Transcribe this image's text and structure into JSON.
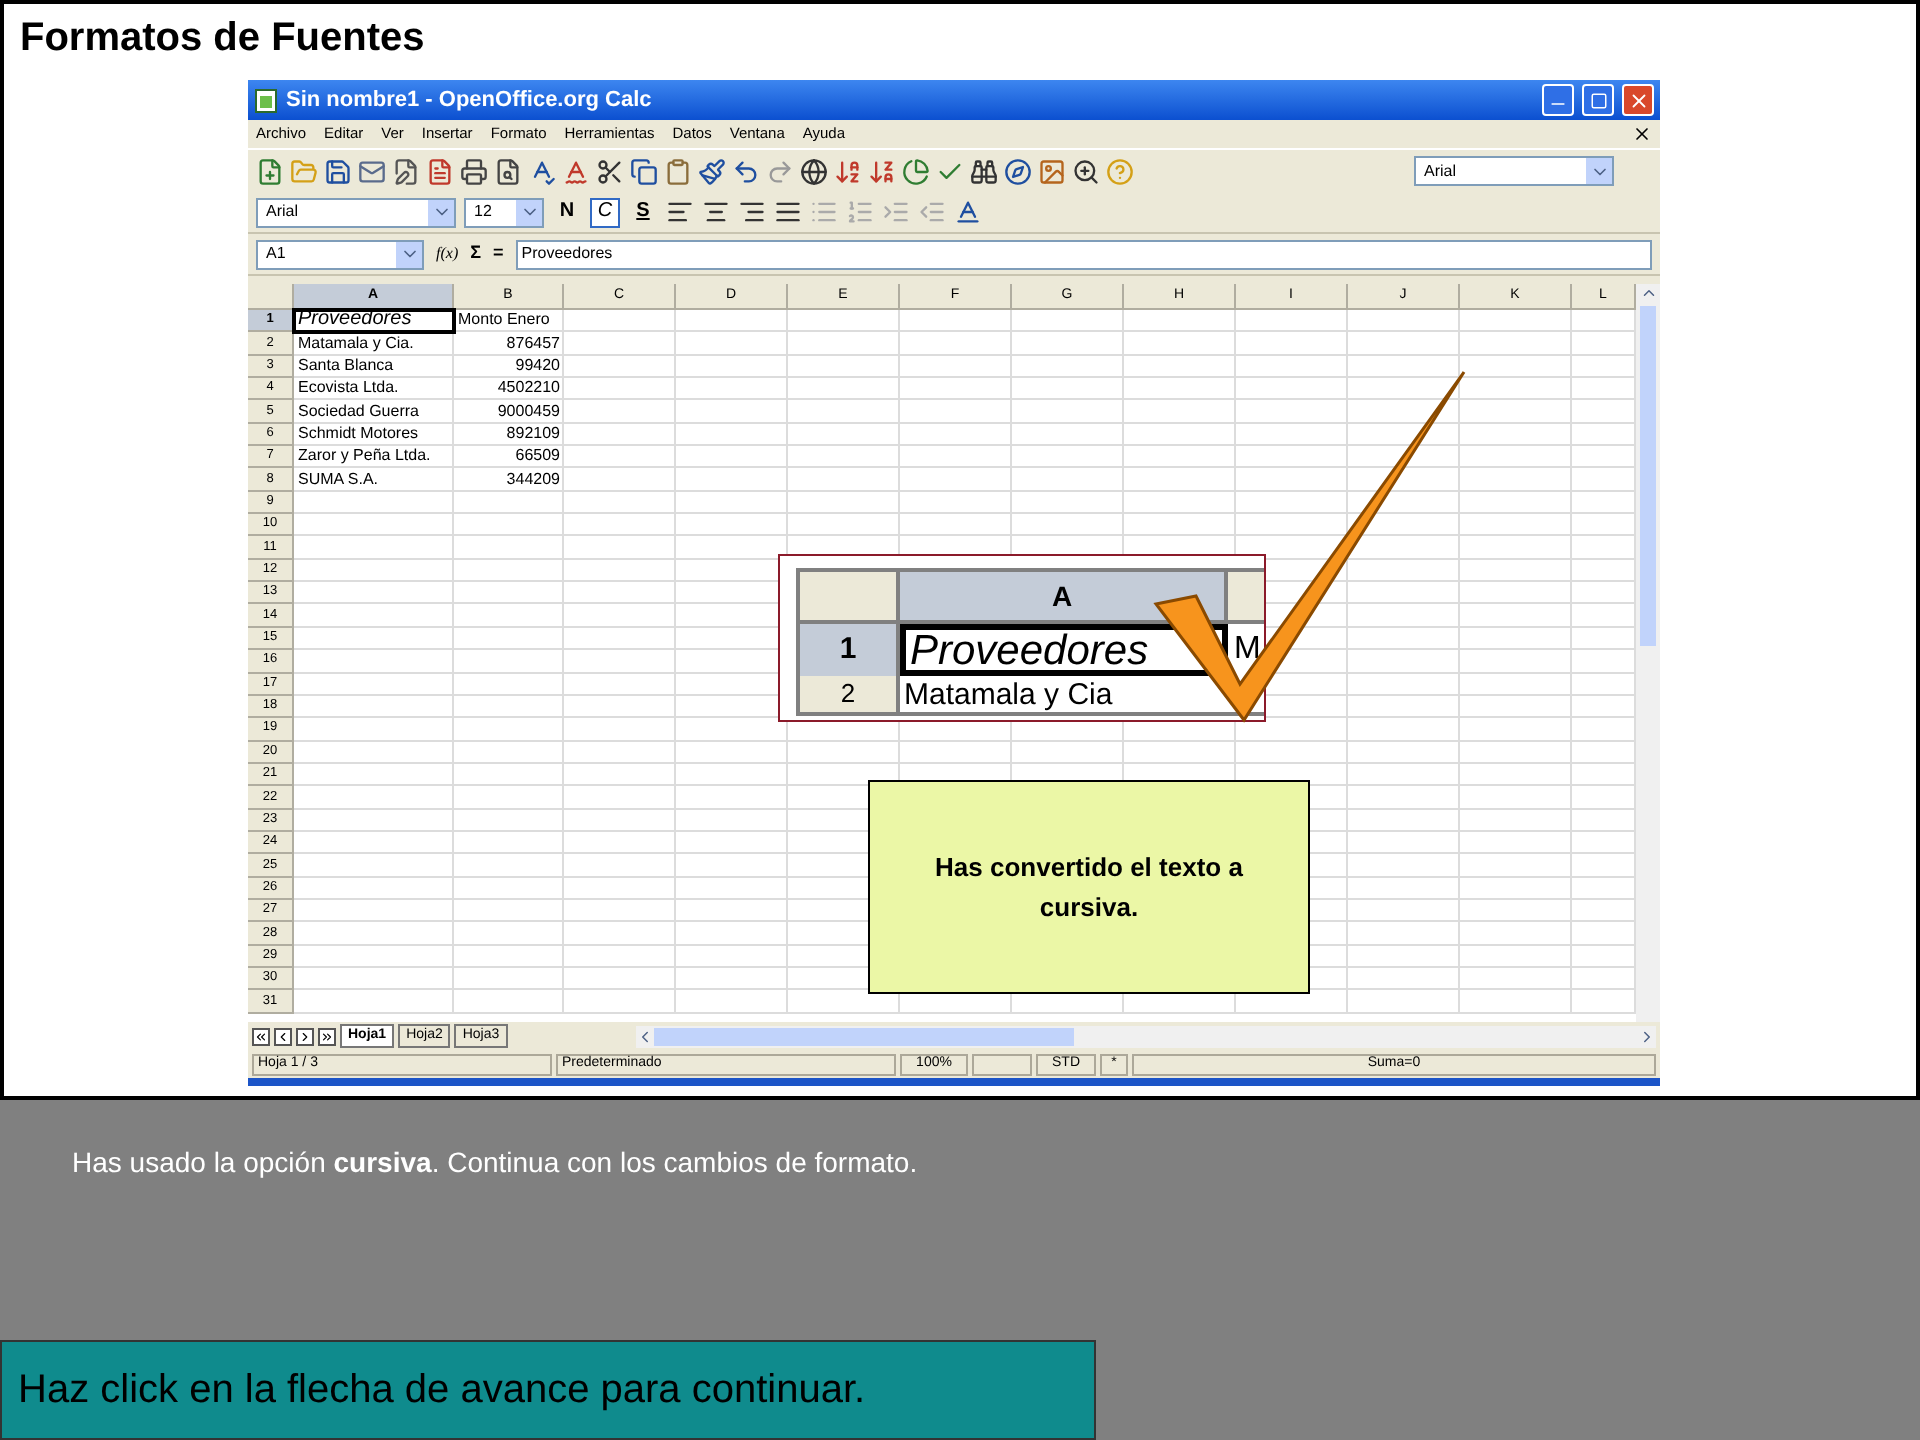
{
  "slide_title": "Formatos de Fuentes",
  "window": {
    "title": "Sin nombre1 - OpenOffice.org Calc"
  },
  "menu": [
    "Archivo",
    "Editar",
    "Ver",
    "Insertar",
    "Formato",
    "Herramientas",
    "Datos",
    "Ventana",
    "Ayuda"
  ],
  "standard_toolbar": {
    "font_box": "Arial"
  },
  "format_toolbar": {
    "font": "Arial",
    "size": "12",
    "bold_label": "N",
    "italic_label": "C",
    "italic_on": true,
    "underline_label": "S"
  },
  "formula_bar": {
    "cell_ref": "A1",
    "function_label": "f(x)",
    "sum_label": "Σ",
    "equals_label": "=",
    "value": "Proveedores"
  },
  "sheet": {
    "columns": [
      {
        "label": "A",
        "selected": true
      },
      {
        "label": "B",
        "selected": false
      },
      {
        "label": "C",
        "selected": false
      },
      {
        "label": "D",
        "selected": false
      },
      {
        "label": "E",
        "selected": false
      },
      {
        "label": "F",
        "selected": false
      },
      {
        "label": "G",
        "selected": false
      },
      {
        "label": "H",
        "selected": false
      },
      {
        "label": "I",
        "selected": false
      },
      {
        "label": "J",
        "selected": false
      },
      {
        "label": "K",
        "selected": false
      },
      {
        "label": "L",
        "selected": false
      }
    ],
    "row_numbers": [
      "1",
      "2",
      "3",
      "4",
      "5",
      "6",
      "7",
      "8",
      "9",
      "10",
      "11",
      "12",
      "13",
      "14",
      "15",
      "16",
      "17",
      "18",
      "19",
      "20",
      "21",
      "22",
      "23",
      "24",
      "25",
      "26",
      "27",
      "28",
      "29",
      "30",
      "31"
    ],
    "rows": [
      {
        "kind": "header",
        "cells": [
          "Proveedores",
          "Monto Enero"
        ],
        "italic": true,
        "selected": true
      },
      {
        "kind": "data",
        "cells": [
          "Matamala y Cia.",
          "876457"
        ],
        "italic": false,
        "selected": false
      },
      {
        "kind": "data",
        "cells": [
          "Santa Blanca",
          "99420"
        ],
        "italic": false,
        "selected": false
      },
      {
        "kind": "data",
        "cells": [
          "Ecovista Ltda.",
          "4502210"
        ],
        "italic": false,
        "selected": false
      },
      {
        "kind": "data",
        "cells": [
          "Sociedad Guerra",
          "9000459"
        ],
        "italic": false,
        "selected": false
      },
      {
        "kind": "data",
        "cells": [
          "Schmidt Motores",
          "892109"
        ],
        "italic": false,
        "selected": false
      },
      {
        "kind": "data",
        "cells": [
          "Zaror y Peña Ltda.",
          "66509"
        ],
        "italic": false,
        "selected": false
      },
      {
        "kind": "data",
        "cells": [
          "SUMA S.A.",
          "344209"
        ],
        "italic": false,
        "selected": false
      }
    ]
  },
  "sheet_tabs": [
    {
      "label": "Hoja1",
      "selected": true
    },
    {
      "label": "Hoja2",
      "selected": false
    },
    {
      "label": "Hoja3",
      "selected": false
    }
  ],
  "status_bar": [
    "Hoja 1 / 3",
    "Predeterminado",
    "100%",
    "STD",
    "*",
    "Suma=0"
  ],
  "inset": {
    "column": "A",
    "row_1": "1",
    "cell_1": "Proveedores",
    "cell_1_next": "M",
    "row_2": "2",
    "cell_2": "Matamala y Cia"
  },
  "callout": "Has convertido el texto a cursiva.",
  "message": "Has usado la opción **cursiva**. Continua con los cambios de formato.",
  "footer": "Haz click en la flecha de avance para continuar."
}
